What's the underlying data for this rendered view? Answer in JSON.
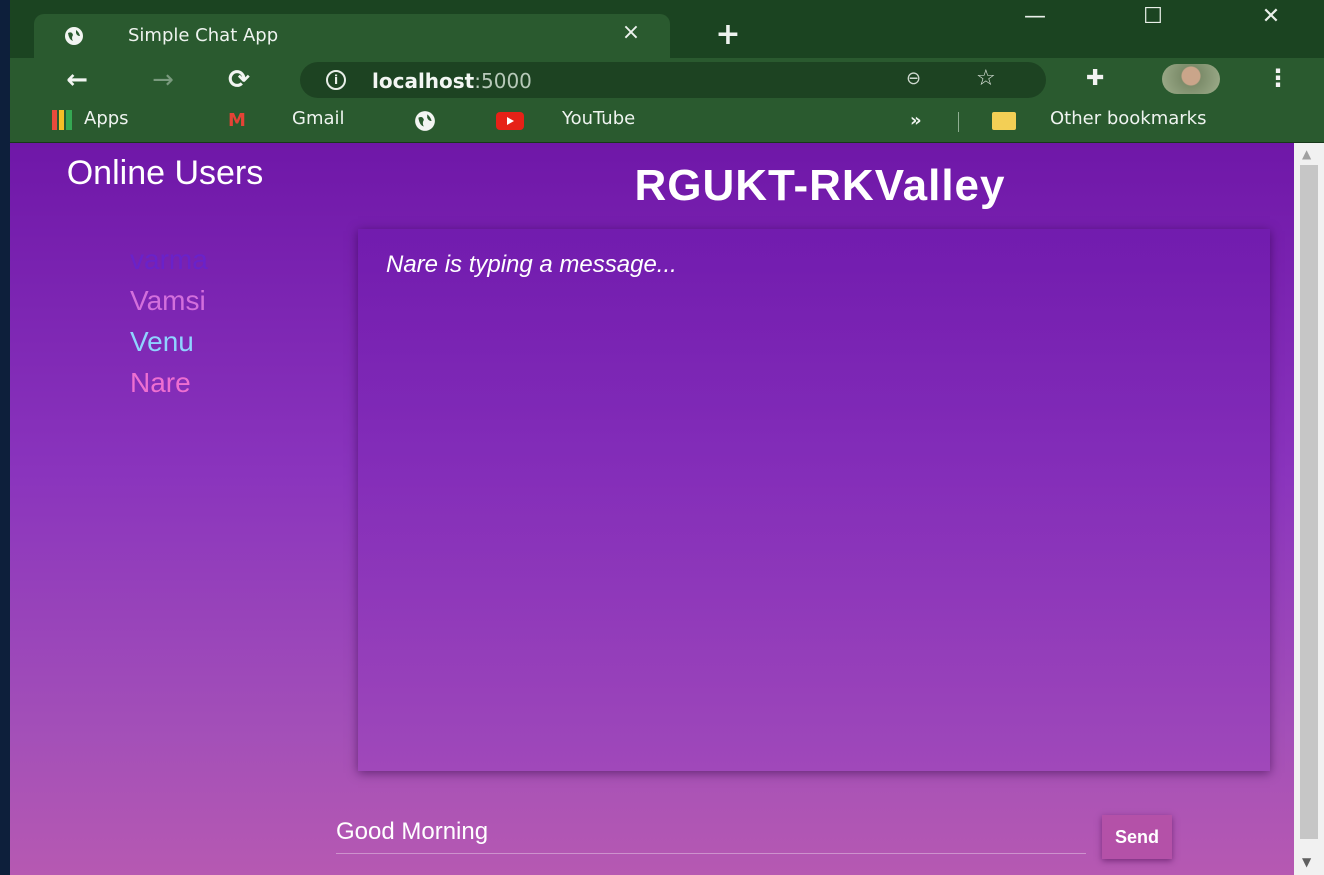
{
  "browser": {
    "tab": {
      "title": "Simple Chat App",
      "close": "×"
    },
    "new_tab": "+",
    "window_controls": {
      "minimize": "—",
      "maximize": "☐",
      "close": "✕"
    },
    "nav": {
      "back": "←",
      "forward": "→",
      "reload": "⟳"
    },
    "address": {
      "host": "localhost",
      "port": ":5000"
    },
    "bookmarks": {
      "apps": "Apps",
      "gmail": "Gmail",
      "youtube": "YouTube",
      "more": "»",
      "other": "Other bookmarks"
    }
  },
  "page": {
    "heading": "RGUKT-RKValley",
    "online_title": "Online Users",
    "users": [
      {
        "name": "varma",
        "color": "#6a22c9"
      },
      {
        "name": "Vamsi",
        "color": "#d36fdc"
      },
      {
        "name": "Venu",
        "color": "#8fd3ff"
      },
      {
        "name": "Nare",
        "color": "#ee6fd1"
      }
    ],
    "typing_indicator": "Nare is typing a message...",
    "message_input": {
      "value": "Good Morning"
    },
    "send_label": "Send"
  },
  "colors": {
    "browser_frame": "#2a5a2f",
    "page_gradient_top": "#6f17a8",
    "page_gradient_bottom": "#b659b2"
  }
}
